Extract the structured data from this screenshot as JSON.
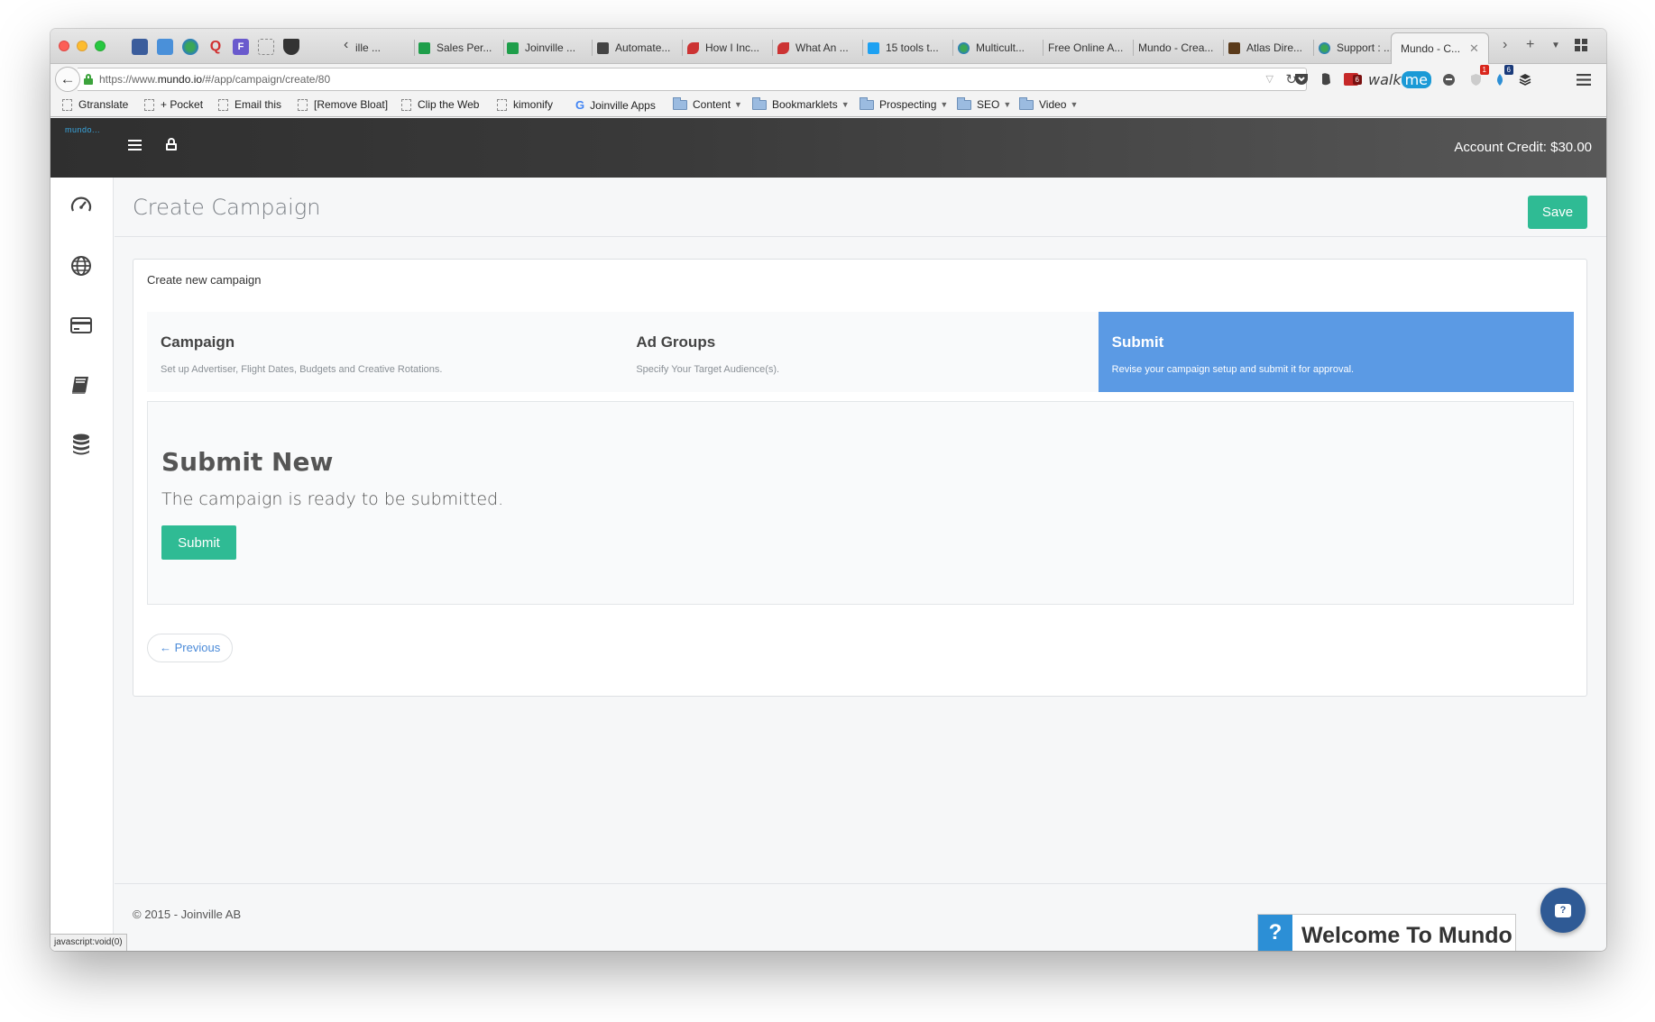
{
  "browser": {
    "tabs": [
      {
        "title": "ille ..."
      },
      {
        "title": "Sales Per..."
      },
      {
        "title": "Joinville ..."
      },
      {
        "title": "Automate..."
      },
      {
        "title": "How I Inc..."
      },
      {
        "title": "What An ..."
      },
      {
        "title": "15 tools t..."
      },
      {
        "title": "Multicult..."
      },
      {
        "title": "Free Online A..."
      },
      {
        "title": "Mundo - Crea..."
      },
      {
        "title": "Atlas Dire..."
      },
      {
        "title": "Support : ..."
      }
    ],
    "active_tab": {
      "title": "Mundo - C..."
    },
    "url_prefix": "https://www.",
    "url_domain": "mundo.io",
    "url_path": "/#/app/campaign/create/80",
    "walkme": {
      "text": "walk",
      "highlight": "me"
    },
    "badge_red": "1",
    "badge_blue": "6",
    "bookmarks": [
      {
        "label": "Gtranslate",
        "icon": "page-icon"
      },
      {
        "label": "+ Pocket",
        "icon": "page-icon"
      },
      {
        "label": "Email this",
        "icon": "page-icon"
      },
      {
        "label": "[Remove Bloat]",
        "icon": "page-icon"
      },
      {
        "label": "Clip the Web",
        "icon": "page-icon"
      },
      {
        "label": "kimonify",
        "icon": "page-icon"
      },
      {
        "label": "Joinville Apps",
        "icon": "google-icon"
      },
      {
        "label": "Content",
        "icon": "folder-icon"
      },
      {
        "label": "Bookmarklets",
        "icon": "folder-icon"
      },
      {
        "label": "Prospecting",
        "icon": "folder-icon"
      },
      {
        "label": "SEO",
        "icon": "folder-icon"
      },
      {
        "label": "Video",
        "icon": "folder-icon"
      }
    ],
    "status_url": "javascript:void(0)"
  },
  "app": {
    "logo_text": "mundo...",
    "account_credit": "Account Credit: $30.00",
    "sidebar": [
      {
        "icon": "dashboard-icon"
      },
      {
        "icon": "globe-icon"
      },
      {
        "icon": "credit-card-icon"
      },
      {
        "icon": "book-icon"
      },
      {
        "icon": "database-icon"
      }
    ],
    "page_title": "Create Campaign",
    "save_label": "Save",
    "panel_heading": "Create new campaign",
    "steps": [
      {
        "title": "Campaign",
        "desc": "Set up Advertiser, Flight Dates, Budgets and Creative Rotations.",
        "active": false
      },
      {
        "title": "Ad Groups",
        "desc": "Specify Your Target Audience(s).",
        "active": false
      },
      {
        "title": "Submit",
        "desc": "Revise your campaign setup and submit it for approval.",
        "active": true
      }
    ],
    "submit_section": {
      "title": "Submit New",
      "text": "The campaign is ready to be submitted.",
      "button": "Submit"
    },
    "previous_label": "← Previous",
    "copyright": "© 2015 - Joinville AB",
    "welcome": {
      "icon_text": "?",
      "text": "Welcome To Mundo"
    },
    "help_bubble_text": "?"
  },
  "colors": {
    "accent_green": "#2fbb94",
    "step_active_blue": "#5b9ae4",
    "header_dark": "#333333"
  }
}
